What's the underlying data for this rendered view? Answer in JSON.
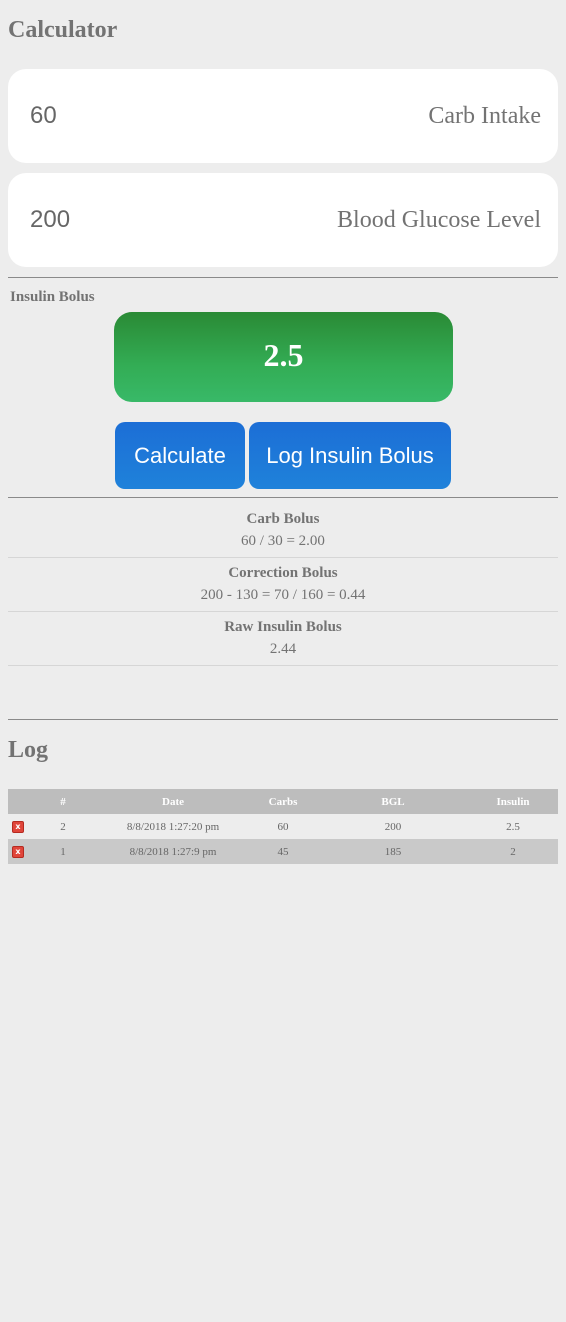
{
  "calculator": {
    "title": "Calculator",
    "carb_intake": {
      "value": "60",
      "label": "Carb Intake"
    },
    "blood_glucose": {
      "value": "200",
      "label": "Blood Glucose Level"
    },
    "bolus_label": "Insulin Bolus",
    "bolus_value": "2.5",
    "calculate_label": "Calculate",
    "log_bolus_label": "Log Insulin Bolus"
  },
  "details": [
    {
      "title": "Carb Bolus",
      "value": "60 / 30 = 2.00"
    },
    {
      "title": "Correction Bolus",
      "value": "200 - 130 = 70 / 160 = 0.44"
    },
    {
      "title": "Raw Insulin Bolus",
      "value": "2.44"
    }
  ],
  "log": {
    "title": "Log",
    "columns": [
      "",
      "#",
      "Date",
      "Carbs",
      "BGL",
      "Insulin"
    ],
    "rows": [
      {
        "delete_icon": "delete-icon",
        "num": "2",
        "date": "8/8/2018 1:27:20 pm",
        "carbs": "60",
        "bgl": "200",
        "insulin": "2.5"
      },
      {
        "delete_icon": "delete-icon",
        "num": "1",
        "date": "8/8/2018 1:27:9 pm",
        "carbs": "45",
        "bgl": "185",
        "insulin": "2"
      }
    ]
  },
  "colors": {
    "background": "#ededed",
    "bolus_green": "#33ad55",
    "button_blue": "#1f78d8",
    "delete_red": "#e0453a"
  }
}
